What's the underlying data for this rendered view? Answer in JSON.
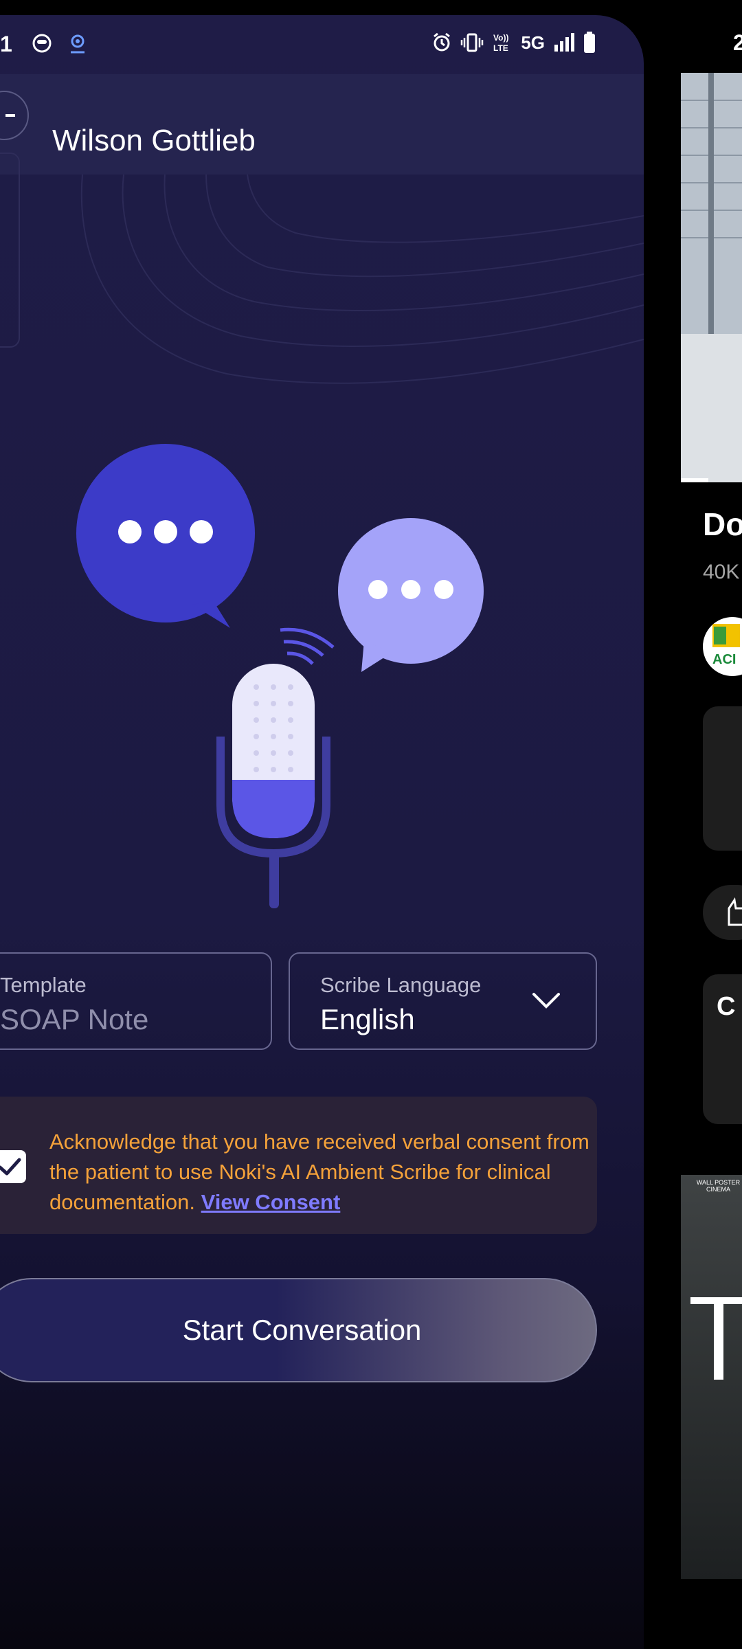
{
  "status_bar": {
    "time": "1",
    "network": "5G"
  },
  "app_bar": {
    "patient_name": "Wilson Gottlieb"
  },
  "template": {
    "label": "Template",
    "value": "SOAP Note"
  },
  "language": {
    "label": "Scribe Language",
    "value": "English"
  },
  "consent": {
    "text": "Acknowledge that you have received verbal consent from the patient to use Noki's AI Ambient Scribe for clinical documentation.",
    "link": "View Consent",
    "checked": true
  },
  "start_button": {
    "label": "Start Conversation"
  },
  "background_app": {
    "time": "2",
    "title": "Do",
    "views": "40K",
    "channel_logo": "ACI",
    "comments_initial": "C",
    "poster_tag": "WALL POSTER CINEMA",
    "poster_letter": "T"
  },
  "colors": {
    "card_bg": "#1e1c45",
    "app_bar": "#25244f",
    "bubble_dark": "#3c3bc8",
    "bubble_light": "#a4a3f9",
    "mic_accent": "#5b56e6",
    "consent_text": "#f5a23a",
    "link": "#7f7bff"
  }
}
